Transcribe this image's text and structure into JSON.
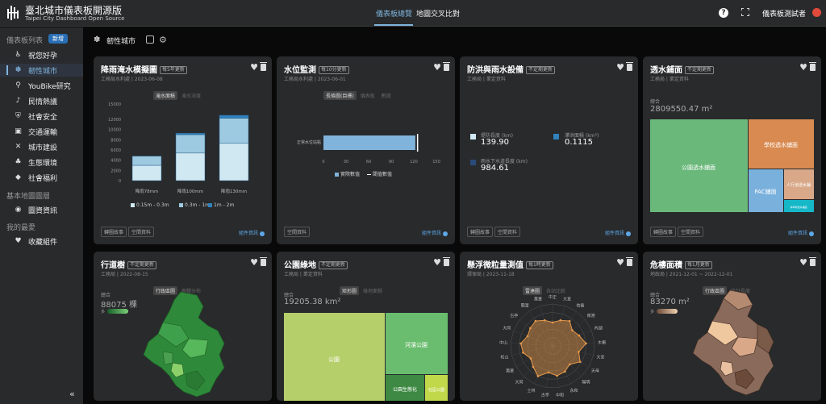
{
  "header": {
    "title": "臺北城市儀表板開源版",
    "subtitle": "Taipei City Dashboard Open Source",
    "tabs": [
      {
        "label": "儀表板總覽"
      },
      {
        "label": "地圖交叉比對"
      }
    ],
    "user": "儀表板測試者"
  },
  "sidebar": {
    "list_header": "儀表板列表",
    "new_button": "新增",
    "items": [
      {
        "label": "祝您好孕",
        "icon": "stroller-icon"
      },
      {
        "label": "韌性城市",
        "icon": "resilience-icon"
      },
      {
        "label": "YouBike研究",
        "icon": "bike-icon"
      },
      {
        "label": "民情熱議",
        "icon": "mic-icon"
      },
      {
        "label": "社會安全",
        "icon": "shield-icon"
      },
      {
        "label": "交通運輸",
        "icon": "bus-icon"
      },
      {
        "label": "城市建設",
        "icon": "tools-icon"
      },
      {
        "label": "生態環境",
        "icon": "leaf-icon"
      },
      {
        "label": "社會福利",
        "icon": "diamond-icon"
      }
    ],
    "basemap_header": "基本地圖圖層",
    "basemap_item": "圖資資訊",
    "fav_header": "我的最愛",
    "fav_item": "收藏組件"
  },
  "page": {
    "title": "韌性城市"
  },
  "common": {
    "map_btn": "空間資料",
    "more_link": "組件資訊",
    "total": "總合"
  },
  "cards": {
    "rain": {
      "title": "降雨淹水模擬圖",
      "badge": "每5年更新",
      "sub": "工務局水利處 | 2023-06-08",
      "tabs": [
        "淹水面積",
        "淹水深度"
      ],
      "foot": "轉圖故事",
      "legend": [
        "0.15m - 0.3m",
        "0.3m - 1m",
        "1m - 2m"
      ]
    },
    "water": {
      "title": "水位監測",
      "badge": "每10分更新",
      "sub": "工務局水利處 | 2023-06-01",
      "tabs": [
        "長條圖(目標)",
        "儀表板",
        "數據"
      ],
      "legend": [
        "實際數值",
        "閾值數值"
      ]
    },
    "flood": {
      "title": "防洪與雨水設備",
      "badge": "不定期更新",
      "sub": "工務局 | 業定資料",
      "foot": "轉圖故事",
      "stats": [
        {
          "label": "堤防長度 (km)",
          "value": "139.90"
        },
        {
          "label": "滯洪面積 (km²)",
          "value": "0.1115"
        },
        {
          "label": "雨水下水道長度 (km)",
          "value": "984.61"
        }
      ]
    },
    "perm": {
      "title": "透水鋪面",
      "badge": "不定期更新",
      "sub": "工務局 | 業定資料",
      "total": "2809550.47 m²",
      "foot": "轉圖故事",
      "cells": [
        "公園透水鋪面",
        "學校透水鋪面",
        "PAC鋪面",
        "人行道透水鋪",
        "停車場透水鋪面"
      ]
    },
    "trees": {
      "title": "行道樹",
      "badge": "不定期更新",
      "sub": "工務局 | 2022-08-15",
      "tabs": [
        "行政區圖",
        "樹種分布"
      ],
      "total": "88075 棵",
      "scale_low": "多"
    },
    "park": {
      "title": "公園綠地",
      "badge": "不定期更新",
      "sub": "工務局 | 業定資料",
      "tabs": [
        "矩形圖",
        "綠地面積"
      ],
      "total": "19205.38 km²",
      "cells": [
        "公園",
        "河濱公園",
        "公園生態化",
        "社區公園"
      ]
    },
    "pm": {
      "title": "懸浮微粒量測值",
      "badge": "每1時更新",
      "sub": "環保局 | 2023-11-18",
      "tabs": [
        "雷達圖",
        "各站比較"
      ],
      "stations": [
        "中正",
        "大直",
        "信義",
        "南港",
        "內湖",
        "木柵",
        "大安",
        "天母",
        "陽明",
        "永和",
        "中和",
        "古亭",
        "士林",
        "大同",
        "萬華",
        "松山",
        "中山",
        "大同",
        "古亭",
        "關渡",
        "萬華"
      ]
    },
    "slope": {
      "title": "危樓面積",
      "badge": "每1月更新",
      "sub": "地政局 | 2021-12-01 ~ 2022-12-01",
      "tabs": [
        "行政區圖",
        "統計長度"
      ],
      "total": "83270 m²",
      "scale_low": "多"
    }
  },
  "chart_data": [
    {
      "type": "bar",
      "title": "降雨淹水模擬圖",
      "categories": [
        "降雨78mm",
        "降雨100mm",
        "降雨130mm"
      ],
      "series": [
        {
          "name": "0.15m - 0.3m",
          "values": [
            3000,
            5400,
            7300
          ]
        },
        {
          "name": "0.3m - 1m",
          "values": [
            1800,
            3600,
            4900
          ]
        },
        {
          "name": "1m - 2m",
          "values": [
            0,
            300,
            600
          ]
        }
      ],
      "ylim": [
        0,
        15000
      ],
      "yticks": [
        0,
        2000,
        4000,
        6000,
        8000,
        10000,
        12000,
        15000
      ]
    },
    {
      "type": "bar",
      "title": "水位監測",
      "categories": [
        "正常水位站點"
      ],
      "series": [
        {
          "name": "實際數值",
          "values": [
            122
          ]
        },
        {
          "name": "閾值數值",
          "values": [
            125
          ]
        }
      ],
      "xlim": [
        0,
        150
      ],
      "xticks": [
        0,
        30,
        60,
        90,
        120,
        150
      ]
    },
    {
      "type": "radar",
      "title": "懸浮微粒量測值",
      "values": [
        14,
        16,
        18,
        15,
        17,
        20,
        16,
        19,
        15,
        17,
        18,
        16,
        20,
        17,
        15,
        18,
        19,
        16,
        17,
        18,
        16
      ],
      "rmax": 25
    }
  ],
  "colors": {
    "accent": "#80b4dc",
    "bar_light": "#d0e8f2",
    "bar_mid": "#9ecae1",
    "bar_dark": "#3182bd",
    "tree_green": "#3e9a3e",
    "park_green": "#b5cf6b",
    "pm_orange": "#e89a4a",
    "slope_tan": "#c9a27e"
  }
}
